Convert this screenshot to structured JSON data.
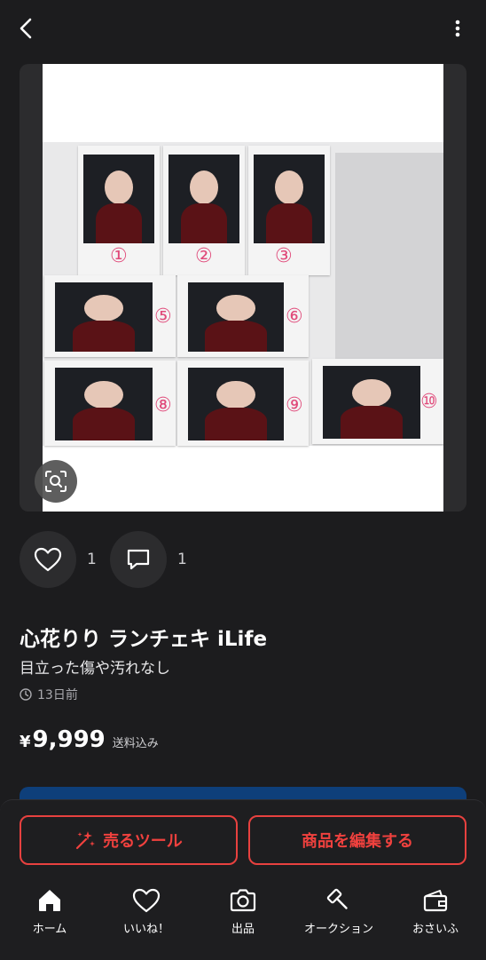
{
  "header": {
    "back_icon": "chevron-left-icon",
    "more_icon": "more-vertical-icon"
  },
  "image": {
    "cheki_numbers": [
      "①",
      "②",
      "③",
      "⑤",
      "⑥",
      "⑧",
      "⑨",
      "⑩"
    ],
    "lens_icon": "image-search-icon"
  },
  "actions": {
    "like_count": "1",
    "comment_count": "1"
  },
  "item": {
    "title": "心花りり ランチェキ iLife",
    "condition": "目立った傷や汚れなし",
    "posted": "13日前",
    "price_symbol": "¥",
    "price": "9,999",
    "shipping": "送料込み"
  },
  "bottom_actions": {
    "sell_tool": "売るツール",
    "edit_item": "商品を編集する"
  },
  "tabs": [
    {
      "label": "ホーム",
      "icon": "home-icon"
    },
    {
      "label": "いいね！",
      "icon": "heart-icon"
    },
    {
      "label": "出品",
      "icon": "camera-icon"
    },
    {
      "label": "オークション",
      "icon": "gavel-icon"
    },
    {
      "label": "おさいふ",
      "icon": "wallet-icon"
    }
  ],
  "colors": {
    "background": "#1c1c1e",
    "accent_red": "#e8413f",
    "number_pink": "#e04a7a",
    "blue_strip": "#0e3f7a"
  }
}
